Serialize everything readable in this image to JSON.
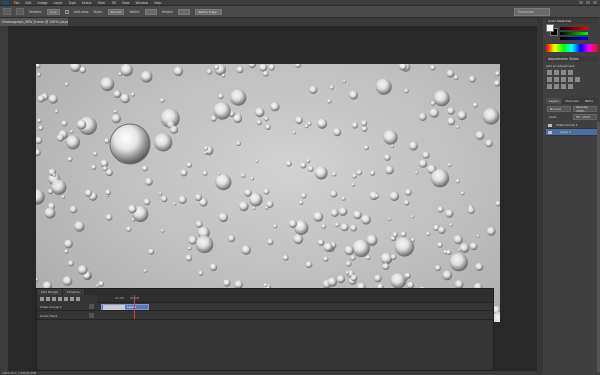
{
  "menubar": {
    "items": [
      "File",
      "Edit",
      "Image",
      "Layer",
      "Type",
      "Select",
      "Filter",
      "3D",
      "View",
      "Window",
      "Help"
    ]
  },
  "options": {
    "feather_label": "Feather:",
    "feather_value": "0 px",
    "antialias_label": "Anti-alias",
    "style_label": "Style:",
    "style_value": "Normal",
    "width_label": "Width:",
    "height_label": "Height:",
    "refine_label": "Refine Edge...",
    "workspace_label": "Essentials"
  },
  "document": {
    "tab_title": "Cinemagraph_MOV_8.mov @ 100% (Layer 1, RGB/8)"
  },
  "timeline": {
    "tabs": [
      "Mini Bridge",
      "Timeline"
    ],
    "ruler_ticks": [
      "01:00f",
      "02:00f"
    ],
    "tracks": [
      {
        "name": "Video Group 1"
      },
      {
        "name": "Audio Track"
      }
    ],
    "clip_label": "Layer 1"
  },
  "status": {
    "zoom_doc": "100%   Doc: 1.45M/4.36M"
  },
  "panels": {
    "color_tabs": [
      "Color",
      "Swatches"
    ],
    "adjustments_tabs": [
      "Adjustments",
      "Styles"
    ],
    "adjustments_subtitle": "Add an adjustment",
    "layers_tabs": [
      "Layers",
      "Channels",
      "Paths"
    ],
    "blend_mode": "Normal",
    "opacity_label": "Opacity: 100%",
    "lock_label": "Lock:",
    "fill_label": "Fill: 100%",
    "layers": [
      {
        "name": "Video Group 1"
      },
      {
        "name": "Layer 1"
      }
    ]
  },
  "colors": {
    "accent": "#5b79b8",
    "panel_bg": "#404040",
    "canvas_bg": "#282828"
  }
}
